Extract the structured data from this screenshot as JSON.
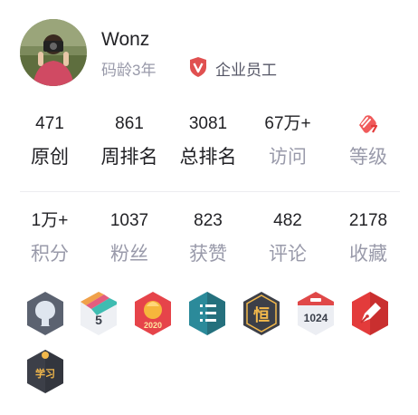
{
  "profile": {
    "name": "Wonz",
    "code_age": "码龄3年",
    "company_label": "企业员工"
  },
  "stats_row1": [
    {
      "value": "471",
      "label": "原创",
      "style": "dark"
    },
    {
      "value": "861",
      "label": "周排名",
      "style": "dark"
    },
    {
      "value": "3081",
      "label": "总排名",
      "style": "dark"
    },
    {
      "value": "67万+",
      "label": "访问",
      "style": "gray"
    },
    {
      "value": "",
      "label": "等级",
      "style": "gray",
      "icon": "level-icon"
    }
  ],
  "stats_row2": [
    {
      "value": "1万+",
      "label": "积分"
    },
    {
      "value": "1037",
      "label": "粉丝"
    },
    {
      "value": "823",
      "label": "获赞"
    },
    {
      "value": "482",
      "label": "评论"
    },
    {
      "value": "2178",
      "label": "收藏"
    }
  ],
  "badges": [
    {
      "icon": "github-badge-icon"
    },
    {
      "icon": "5-years-badge-icon",
      "text": "5"
    },
    {
      "icon": "2020-badge-icon",
      "text": "2020"
    },
    {
      "icon": "list-badge-icon"
    },
    {
      "icon": "persistence-badge-icon",
      "text": "恒"
    },
    {
      "icon": "1024-badge-icon",
      "text": "1024"
    },
    {
      "icon": "pen-badge-icon"
    },
    {
      "icon": "study-badge-icon",
      "text": "学习"
    }
  ],
  "colors": {
    "accent_red": "#e33b3b",
    "text_dark": "#222226",
    "text_gray": "#999aaa"
  }
}
